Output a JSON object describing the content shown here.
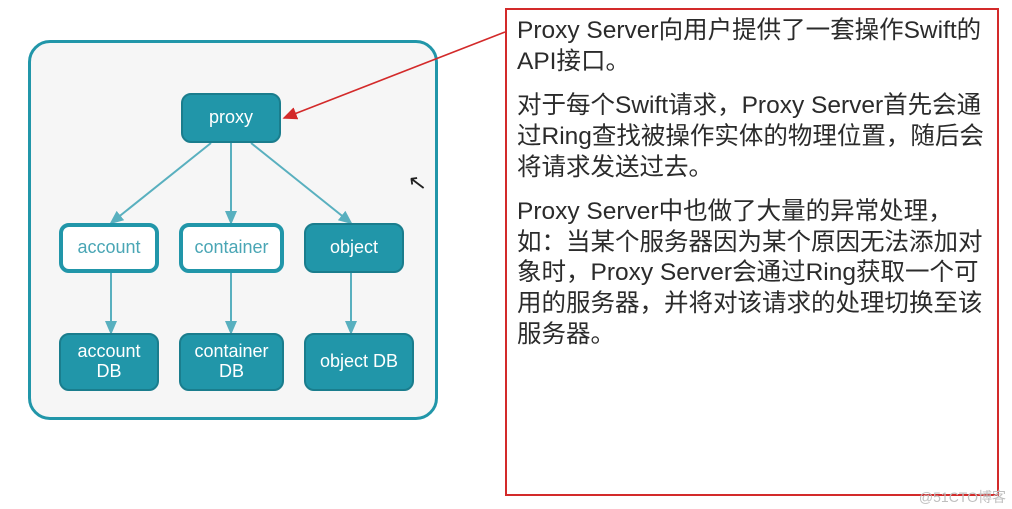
{
  "diagram": {
    "nodes": {
      "proxy": "proxy",
      "account": "account",
      "container": "container",
      "object": "object",
      "accountDB": "account\nDB",
      "containerDB": "container\nDB",
      "objectDB": "object DB"
    }
  },
  "description": {
    "p1": "Proxy Server向用户提供了一套操作Swift的API接口。",
    "p2": "对于每个Swift请求，Proxy Server首先会通过Ring查找被操作实体的物理位置，随后会将请求发送过去。",
    "p3": "Proxy Server中也做了大量的异常处理，如：当某个服务器因为某个原因无法添加对象时，Proxy Server会通过Ring获取一个可用的服务器，并将对该请求的处理切换至该服务器。"
  },
  "colors": {
    "teal": "#2196a9",
    "tealLight": "#59b0bf",
    "redBorder": "#d32a2a",
    "panelBg": "#f6f6f6"
  },
  "watermark": "@51CTO博客",
  "cursorGlyph": "↖"
}
